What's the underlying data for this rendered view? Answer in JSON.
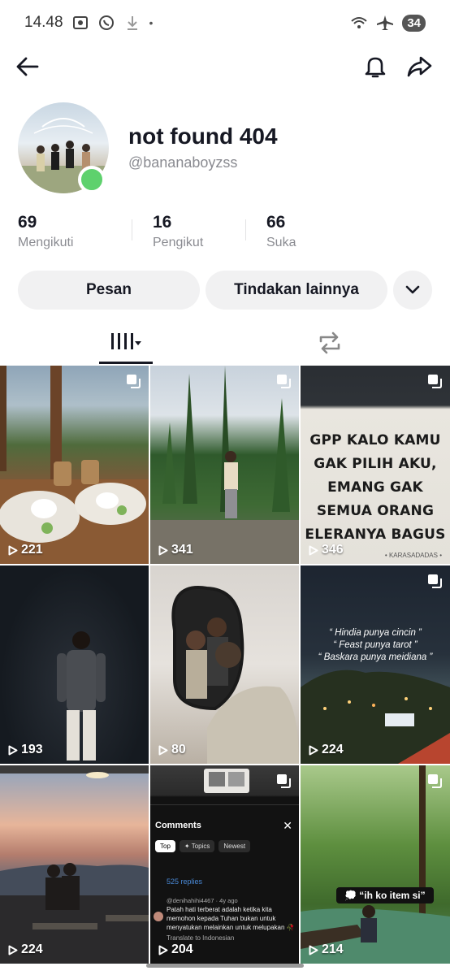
{
  "status_bar": {
    "time": "14.48",
    "separator": "•",
    "battery": "34"
  },
  "profile": {
    "display_name": "not found 404",
    "username": "@bananaboyzss",
    "online_color": "#5ed16d"
  },
  "stats": [
    {
      "value": "69",
      "label": "Mengikuti"
    },
    {
      "value": "16",
      "label": "Pengikut"
    },
    {
      "value": "66",
      "label": "Suka"
    }
  ],
  "actions": {
    "message": "Pesan",
    "more": "Tindakan lainnya"
  },
  "videos": [
    {
      "views": "221",
      "multi": true
    },
    {
      "views": "341",
      "multi": true
    },
    {
      "views": "346",
      "multi": true,
      "overlay": [
        "GPP KALO KAMU",
        "GAK PILIH AKU,",
        "EMANG GAK",
        "SEMUA ORANG",
        "ELERANYA BAGUS"
      ],
      "caption": "• KARASADADAS •"
    },
    {
      "views": "193",
      "multi": false
    },
    {
      "views": "80",
      "multi": false
    },
    {
      "views": "224",
      "multi": true,
      "quotes": [
        "“ Hindia punya cincin ”",
        "“ Feast punya tarot ”",
        "“ Baskara punya meidiana ”"
      ]
    },
    {
      "views": "224",
      "multi": false
    },
    {
      "views": "204",
      "multi": true,
      "screenshot": {
        "header": "Comments",
        "chips": [
          "Top",
          "✦ Topics",
          "Newest"
        ],
        "replies": "525 replies",
        "meta": "@denihahihi4467 · 4y ago",
        "comment": "Patah hati terberat adalah ketika kita memohon kepada Tuhan  bukan untuk menyatukan melainkan untuk melupakan 🥀",
        "translate": "Translate to Indonesian"
      }
    },
    {
      "views": "214",
      "multi": true,
      "pill": "💭 “ih ko item si”"
    }
  ]
}
